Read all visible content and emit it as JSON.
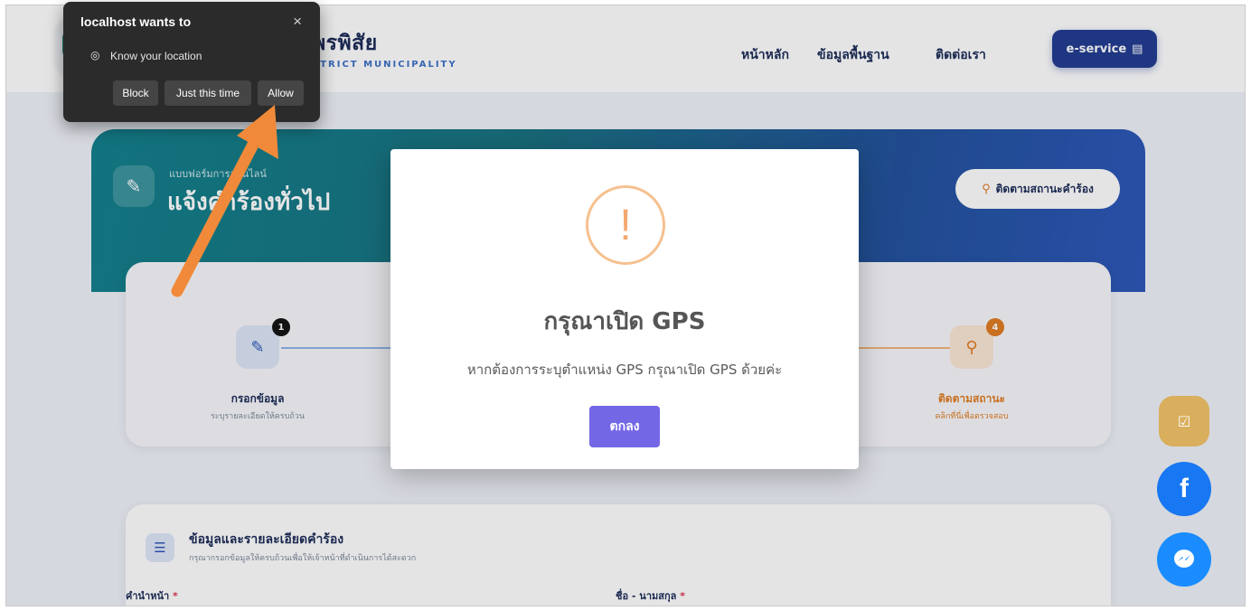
{
  "header": {
    "title": "พรพิสัย",
    "subtitle": "STRICT MUNICIPALITY",
    "nav": [
      "หน้าหลัก",
      "ข้อมูลพื้นฐาน",
      "ติดต่อเรา"
    ],
    "eservice_label": "e-service"
  },
  "banner": {
    "small": "แบบฟอร์มการออนไลน์",
    "title": "แจ้งคำร้องทั่วไป",
    "track_label": "ติดตามสถานะคำร้อง"
  },
  "steps": [
    {
      "badge": "1",
      "label": "กรอกข้อมูล",
      "sub": "ระบุรายละเอียดให้ครบถ้วน",
      "color": "#2b55b8"
    },
    {
      "badge": "4",
      "label": "ติดตามสถานะ",
      "sub": "คลิกที่นี่เพื่อตรวจสอบ",
      "color": "#e07a1f"
    }
  ],
  "details": {
    "title": "ข้อมูลและรายละเอียดคำร้อง",
    "sub": "กรุณากรอกข้อมูลให้ครบถ้วนเพื่อให้เจ้าหน้าที่ดำเนินการได้สะดวก",
    "field1": "คำนำหน้า",
    "field2": "ชื่อ - นามสกุล",
    "required_mark": "*"
  },
  "modal": {
    "icon": "!",
    "title": "กรุณาเปิด GPS",
    "text": "หากต้องการระบุตำแหน่ง GPS กรุณาเปิด GPS ด้วยค่ะ",
    "ok_label": "ตกลง"
  },
  "permission": {
    "title": "localhost wants to",
    "request": "Know your location",
    "block_label": "Block",
    "once_label": "Just this time",
    "allow_label": "Allow",
    "close_icon": "×"
  },
  "colors": {
    "accent": "#7367e6",
    "navy": "#1a2a55",
    "orange": "#e07a1f",
    "arrow": "#f08a3a",
    "fab_gold": "#d9ae5c",
    "fab_facebook": "#1877f2",
    "fab_messenger": "#1a8cff"
  }
}
